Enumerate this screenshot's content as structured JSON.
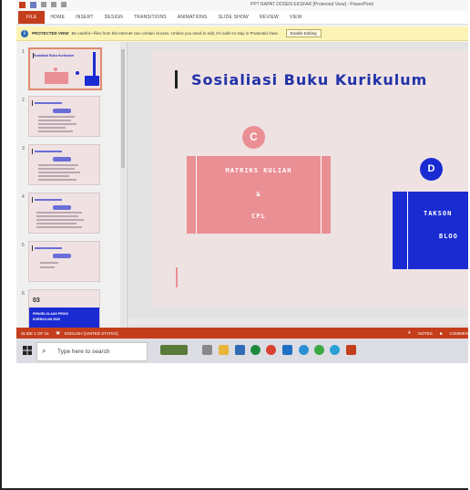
{
  "window": {
    "title": "PPT RAPAT DOSEN EKSFAR [Protected View] - PowerPoint"
  },
  "ribbon": {
    "tabs": [
      "FILE",
      "HOME",
      "INSERT",
      "DESIGN",
      "TRANSITIONS",
      "ANIMATIONS",
      "SLIDE SHOW",
      "REVIEW",
      "VIEW"
    ]
  },
  "protected_view": {
    "label": "PROTECTED VIEW",
    "message": "Be careful—files from the Internet can contain viruses. Unless you need to edit, it's safer to stay in Protected View.",
    "button": "Enable Editing"
  },
  "thumbnails": {
    "numbers": [
      "1",
      "2",
      "3",
      "4",
      "5",
      "6"
    ],
    "slide1_title": "Sosialiasi Buku Kurikulum",
    "slide6_number": "03",
    "slide6_text_1": "PENGELOLAAN PRODI",
    "slide6_text_2": "KURIKULUM 2020"
  },
  "slide": {
    "title": "Sosialiasi Buku Kurikulum",
    "circle_c": "C",
    "box_c_line1": "MATRIKS KULIAH",
    "box_c_line2": "&",
    "box_c_line3": "CPL",
    "circle_d": "D",
    "box_d_line1": "TAKSON",
    "box_d_line2": "BLOO"
  },
  "statusbar": {
    "slide_info": "SLIDE 1 OF 15",
    "language": "ENGLISH (UNITED STATES)",
    "notes": "NOTES",
    "comments": "COMMEN"
  },
  "taskbar": {
    "search_placeholder": "Type here to search"
  },
  "colors": {
    "ppt_accent": "#c43e1c",
    "slide_bg": "#efe2e3",
    "pink": "#ea8f94",
    "blue": "#1a2bd2",
    "title_blue": "#2233a8"
  }
}
